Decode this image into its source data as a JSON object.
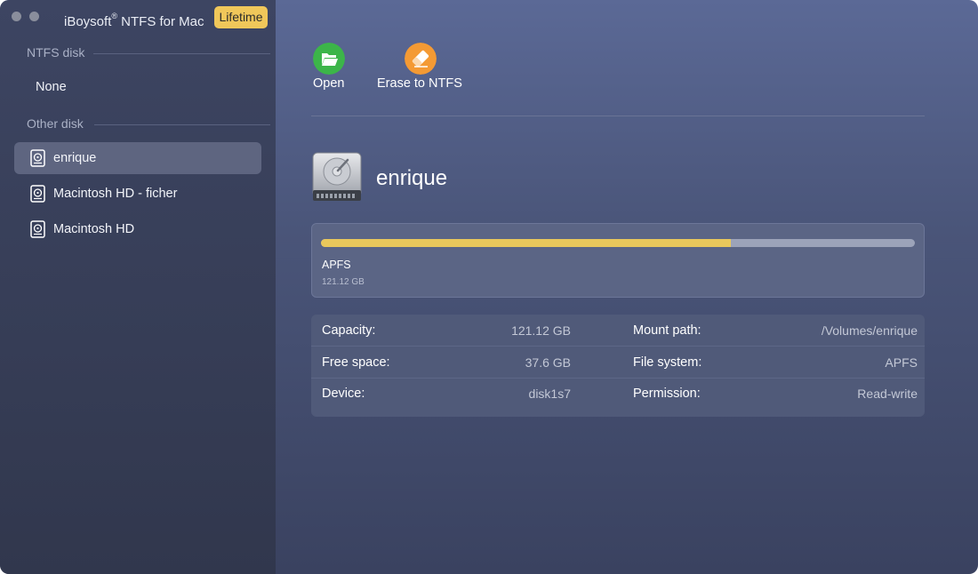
{
  "window": {
    "title": "iBoysoft",
    "title_sup": "®",
    "title_suffix": " NTFS for Mac",
    "badge": "Lifetime"
  },
  "sidebar": {
    "ntfs_section": "NTFS disk",
    "ntfs_empty": "None",
    "other_section": "Other disk",
    "items": [
      {
        "label": "enrique",
        "selected": true,
        "icon": "hard-drive-icon"
      },
      {
        "label": "Macintosh HD - ficher",
        "selected": false,
        "icon": "hard-drive-icon"
      },
      {
        "label": "Macintosh HD",
        "selected": false,
        "icon": "hard-drive-icon"
      }
    ]
  },
  "toolbar": {
    "open_label": "Open",
    "open_icon": "folder-open-icon",
    "open_color": "#3cb549",
    "erase_label": "Erase to NTFS",
    "erase_icon": "eraser-icon",
    "erase_color": "#f49a34"
  },
  "disk": {
    "name": "enrique",
    "filesystem": "APFS",
    "capacity": "121.12 GB",
    "used_fraction": 0.69,
    "bar_color": "#e9c85c"
  },
  "info": {
    "capacity_label": "Capacity:",
    "capacity_value": "121.12 GB",
    "free_label": "Free space:",
    "free_value": "37.6 GB",
    "device_label": "Device:",
    "device_value": "disk1s7",
    "mount_label": "Mount path:",
    "mount_value": "/Volumes/enrique",
    "fs_label": "File system:",
    "fs_value": "APFS",
    "perm_label": "Permission:",
    "perm_value": "Read-write"
  }
}
